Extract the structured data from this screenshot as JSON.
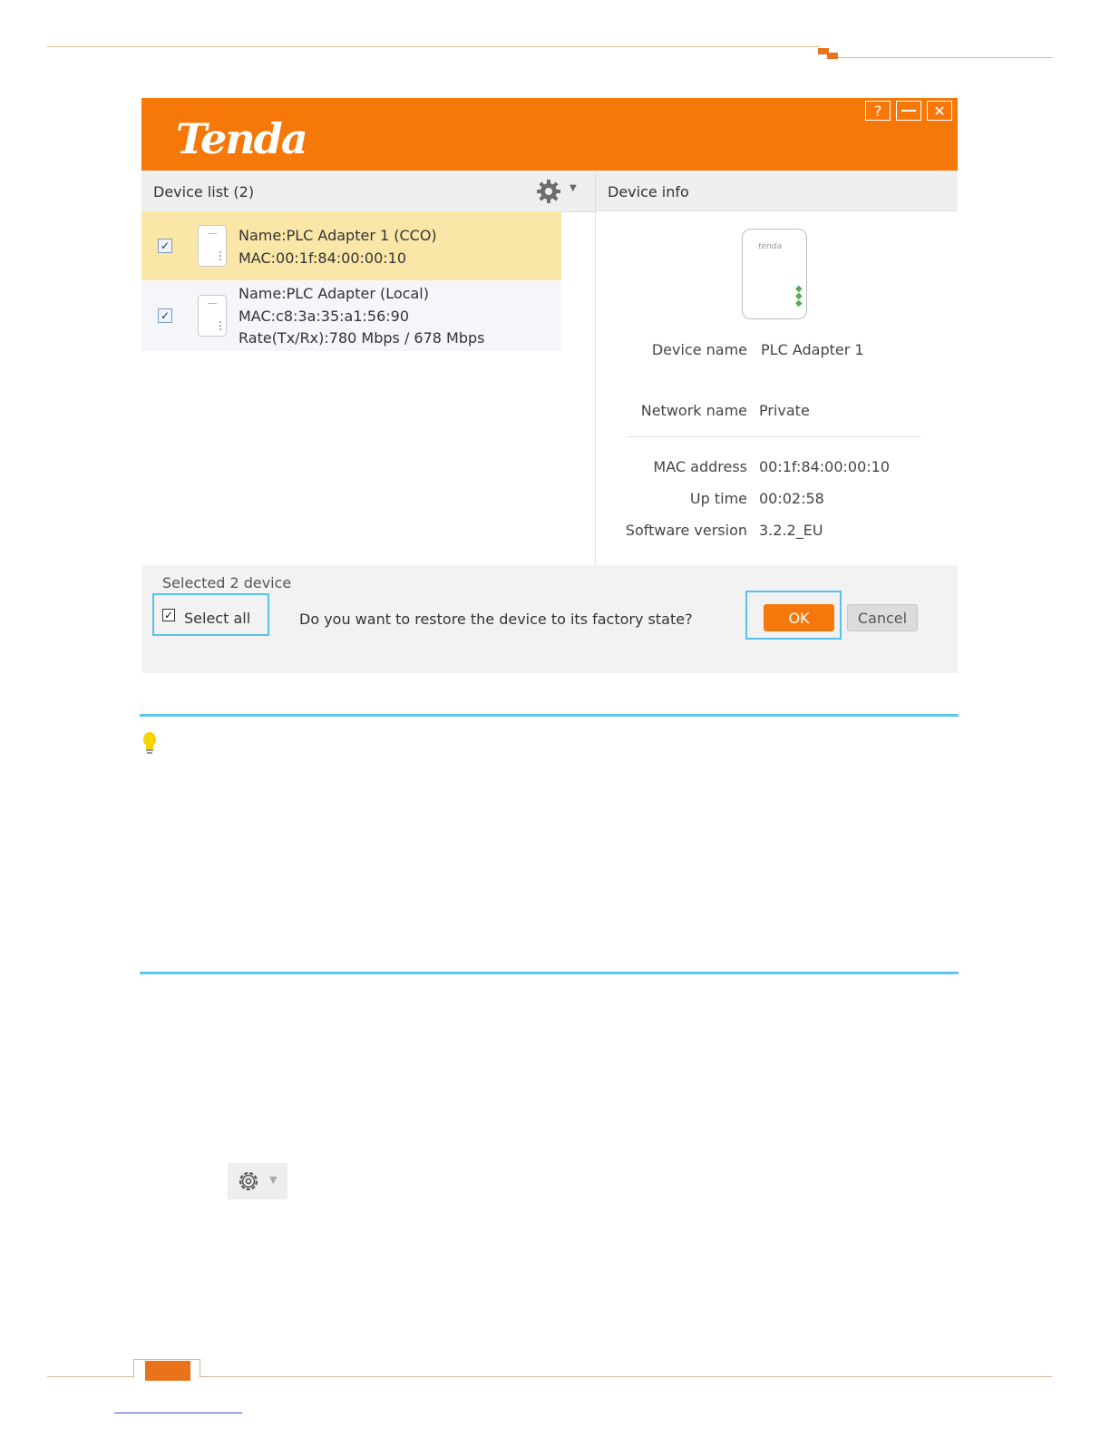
{
  "app": {
    "logo": "Tenda",
    "window_buttons": {
      "help": "?",
      "minimize": "—",
      "close": "✕"
    }
  },
  "device_list": {
    "title": "Device list (2)",
    "items": [
      {
        "name": "Name:PLC Adapter 1 (CCO)",
        "mac": "MAC:00:1f:84:00:00:10",
        "rate": "",
        "checked": true,
        "selected": true
      },
      {
        "name": "Name:PLC Adapter (Local)",
        "mac": "MAC:c8:3a:35:a1:56:90",
        "rate": "Rate(Tx/Rx):780 Mbps / 678 Mbps",
        "checked": true,
        "selected": false
      }
    ]
  },
  "device_info": {
    "title": "Device info",
    "image_logo": "tenda",
    "fields": {
      "device_name": {
        "label": "Device name",
        "value": "PLC Adapter 1"
      },
      "network_name": {
        "label": "Network name",
        "value": "Private"
      },
      "mac_address": {
        "label": "MAC address",
        "value": "00:1f:84:00:00:10"
      },
      "up_time": {
        "label": "Up time",
        "value": "00:02:58"
      },
      "software_version": {
        "label": "Software version",
        "value": "3.2.2_EU"
      }
    }
  },
  "footer": {
    "selected_count": "Selected 2 device",
    "select_all_label": "Select all",
    "select_all_checked": true,
    "question": "Do you want to restore the device to its factory state?",
    "ok_label": "OK",
    "cancel_label": "Cancel"
  },
  "icons": {
    "settings": "gear-icon",
    "tip": "lightbulb-icon"
  },
  "colors": {
    "brand_orange": "#f57809",
    "highlight_row": "#fae7a8",
    "callout_blue": "#58c2ec"
  }
}
